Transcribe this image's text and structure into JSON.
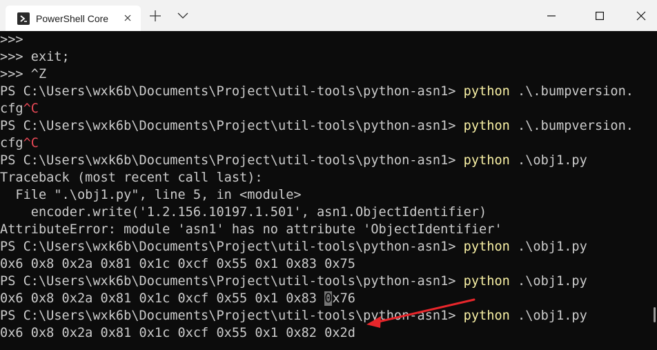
{
  "tab": {
    "title": "PowerShell Core",
    "icon": "powershell-icon"
  },
  "toolbar": {
    "new_tab_icon": "+",
    "dropdown_icon": "chevron-down"
  },
  "window_controls": {
    "minimize": "minimize-icon",
    "maximize": "maximize-icon",
    "close": "close-icon"
  },
  "terminal": {
    "lines": [
      {
        "segments": [
          {
            "text": ">>>"
          }
        ]
      },
      {
        "segments": [
          {
            "text": ">>> exit;"
          }
        ]
      },
      {
        "segments": [
          {
            "text": ">>> ^Z"
          }
        ]
      },
      {
        "segments": [
          {
            "text": "PS C:\\Users\\wxk6b\\Documents\\Project\\util-tools\\python-asn1> "
          },
          {
            "text": "python",
            "style": "cmd"
          },
          {
            "text": " .\\.bumpversion."
          }
        ]
      },
      {
        "segments": [
          {
            "text": "cfg"
          },
          {
            "text": "^C",
            "style": "ctrl"
          }
        ]
      },
      {
        "segments": [
          {
            "text": "PS C:\\Users\\wxk6b\\Documents\\Project\\util-tools\\python-asn1> "
          },
          {
            "text": "python",
            "style": "cmd"
          },
          {
            "text": " .\\.bumpversion."
          }
        ]
      },
      {
        "segments": [
          {
            "text": "cfg"
          },
          {
            "text": "^C",
            "style": "ctrl"
          }
        ]
      },
      {
        "segments": [
          {
            "text": "PS C:\\Users\\wxk6b\\Documents\\Project\\util-tools\\python-asn1> "
          },
          {
            "text": "python",
            "style": "cmd"
          },
          {
            "text": " .\\obj1.py"
          }
        ]
      },
      {
        "segments": [
          {
            "text": "Traceback (most recent call last):"
          }
        ]
      },
      {
        "segments": [
          {
            "text": "  File \".\\obj1.py\", line 5, in <module>"
          }
        ]
      },
      {
        "segments": [
          {
            "text": "    encoder.write('1.2.156.10197.1.501', asn1.ObjectIdentifier)"
          }
        ]
      },
      {
        "segments": [
          {
            "text": "AttributeError: module 'asn1' has no attribute 'ObjectIdentifier'"
          }
        ]
      },
      {
        "segments": [
          {
            "text": "PS C:\\Users\\wxk6b\\Documents\\Project\\util-tools\\python-asn1> "
          },
          {
            "text": "python",
            "style": "cmd"
          },
          {
            "text": " .\\obj1.py"
          }
        ]
      },
      {
        "segments": [
          {
            "text": "0x6 0x8 0x2a 0x81 0x1c 0xcf 0x55 0x1 0x83 0x75"
          }
        ]
      },
      {
        "segments": [
          {
            "text": "PS C:\\Users\\wxk6b\\Documents\\Project\\util-tools\\python-asn1> "
          },
          {
            "text": "python",
            "style": "cmd"
          },
          {
            "text": " .\\obj1.py"
          }
        ]
      },
      {
        "segments": [
          {
            "text": "0x6 0x8 0x2a 0x81 0x1c 0xcf 0x55 0x1 0x83 "
          },
          {
            "text": "0",
            "style": "cursor"
          },
          {
            "text": "x76"
          }
        ]
      },
      {
        "segments": [
          {
            "text": "PS C:\\Users\\wxk6b\\Documents\\Project\\util-tools\\python-asn1> "
          },
          {
            "text": "python",
            "style": "cmd"
          },
          {
            "text": " .\\obj1.py"
          }
        ]
      },
      {
        "segments": [
          {
            "text": "0x6 0x8 0x2a 0x81 0x1c 0xcf 0x55 0x1 0x82 0x2d"
          }
        ]
      }
    ]
  },
  "colors": {
    "background": "#0c0c0c",
    "foreground": "#cccccc",
    "command": "#f9f1a5",
    "ctrl": "#e74856",
    "arrow": "#e8262b"
  }
}
